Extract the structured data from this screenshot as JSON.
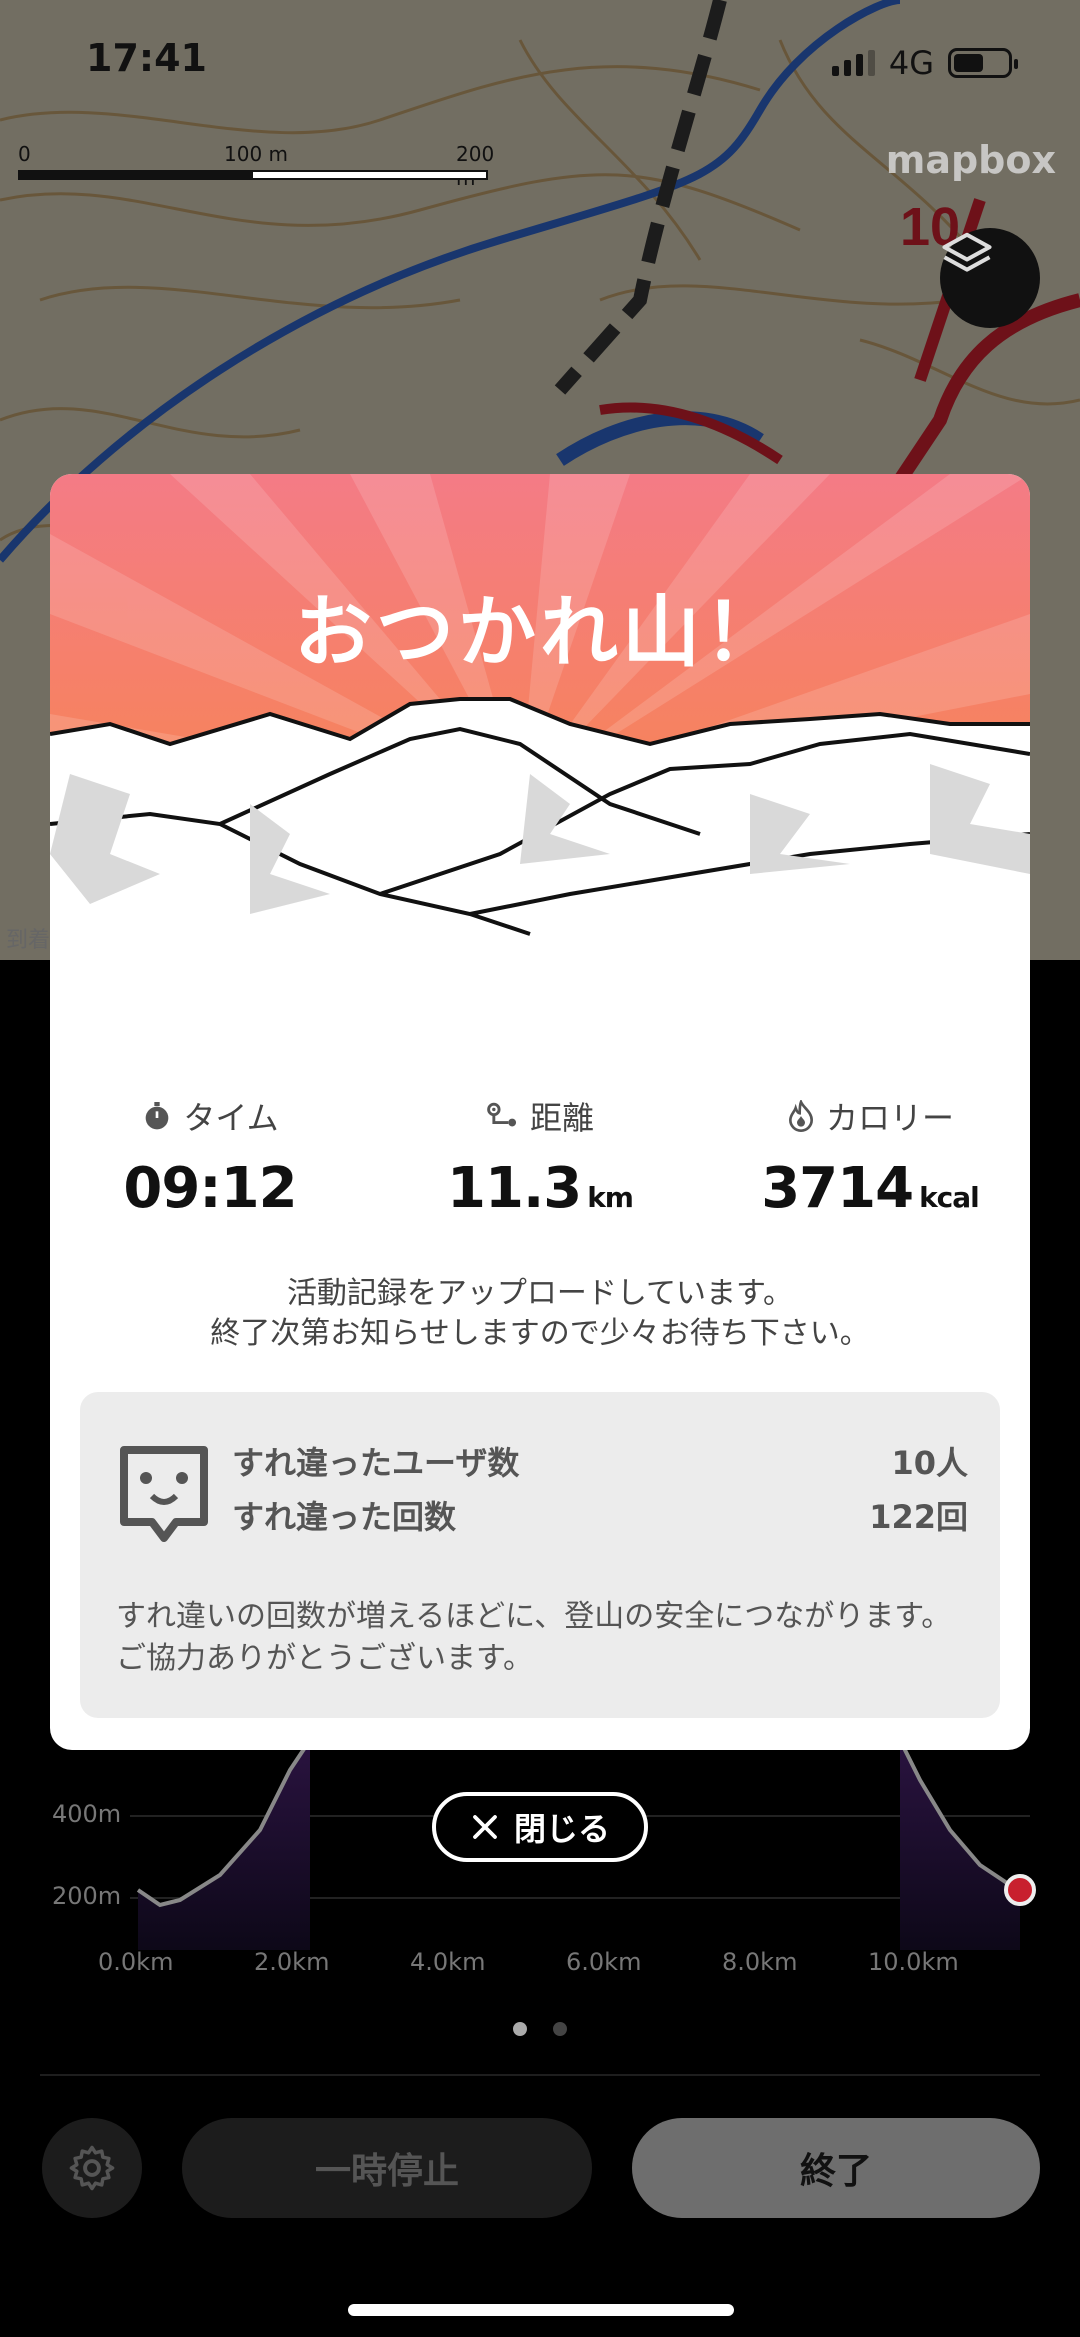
{
  "status_bar": {
    "time": "17:41",
    "network": "4G"
  },
  "map": {
    "scale": {
      "labels": [
        "0",
        "100 m",
        "200 m"
      ]
    },
    "attribution": "mapbox",
    "label_10": "10"
  },
  "panel": {
    "arrive_label": "到着",
    "chart": {
      "y_labels": [
        "400m",
        "200m"
      ],
      "x_labels": [
        "0.0km",
        "2.0km",
        "4.0km",
        "6.0km",
        "8.0km",
        "10.0km"
      ]
    },
    "pause_label": "一時停止",
    "end_label": "終了"
  },
  "modal": {
    "title": "おつかれ山！",
    "stats": [
      {
        "icon": "stopwatch-icon",
        "label": "タイム",
        "value": "09:12",
        "unit": ""
      },
      {
        "icon": "route-icon",
        "label": "距離",
        "value": "11.3",
        "unit": "km"
      },
      {
        "icon": "flame-icon",
        "label": "カロリー",
        "value": "3714",
        "unit": "kcal"
      }
    ],
    "upload_message": [
      "活動記録をアップロードしています。",
      "終了次第お知らせしますので少々お待ち下さい。"
    ],
    "passing": {
      "users_label": "すれ違ったユーザ数",
      "users_value": "10人",
      "count_label": "すれ違った回数",
      "count_value": "122回",
      "note": "すれ違いの回数が増えるほどに、登山の安全につながります。ご協力ありがとうございます。"
    },
    "close_label": "閉じる"
  },
  "colors": {
    "hero_top": "#f47b86",
    "hero_bottom": "#f98a36",
    "track_blue": "#2f63c8",
    "track_red": "#c8202e"
  }
}
